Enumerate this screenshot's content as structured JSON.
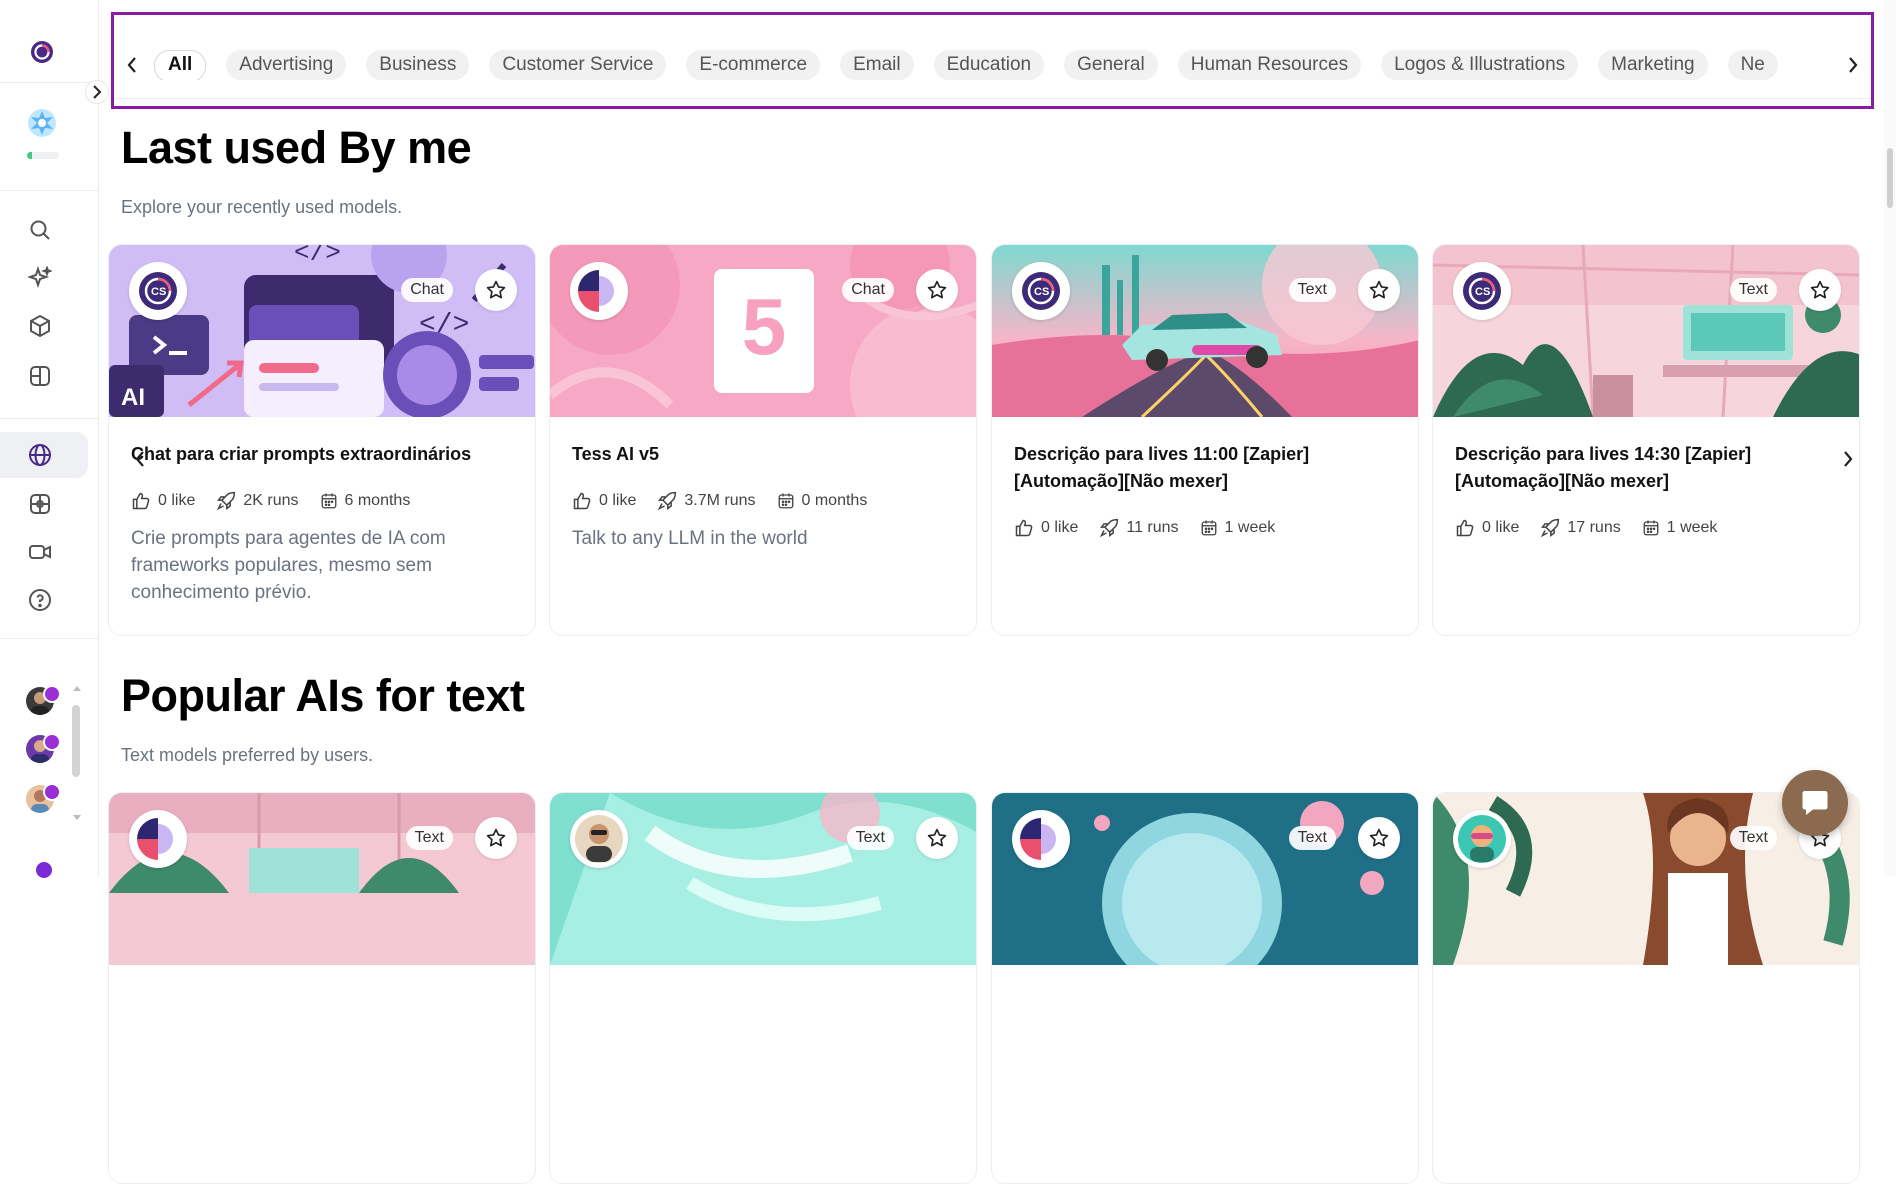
{
  "sidebar": {
    "progress_fraction": 0.15,
    "nav_icons": [
      "search-icon",
      "sparkle-icon",
      "cube-icon",
      "layout-icon",
      "globe-icon",
      "film-grid-icon",
      "video-icon",
      "help-icon"
    ],
    "active_item": "globe-icon"
  },
  "categories": {
    "items": [
      "All",
      "Advertising",
      "Business",
      "Customer Service",
      "E-commerce",
      "Email",
      "Education",
      "General",
      "Human Resources",
      "Logos & Illustrations",
      "Marketing",
      "Ne"
    ],
    "active": "All"
  },
  "recent": {
    "title": "Last used By me",
    "subtitle": "Explore your recently used models.",
    "cards": [
      {
        "badge": "Chat",
        "title": "Chat para criar prompts extraordinários",
        "likes": "0 like",
        "runs": "2K runs",
        "age": "6 months",
        "description": "Crie prompts para agentes de IA com frameworks populares, mesmo sem conhecimento prévio."
      },
      {
        "badge": "Chat",
        "title": "Tess AI v5",
        "image_text": "5",
        "likes": "0 like",
        "runs": "3.7M runs",
        "age": "0 months",
        "description": "Talk to any LLM in the world"
      },
      {
        "badge": "Text",
        "title": "Descrição para lives 11:00 [Zapier] [Automação][Não mexer]",
        "likes": "0 like",
        "runs": "11 runs",
        "age": "1 week",
        "description": ""
      },
      {
        "badge": "Text",
        "title": "Descrição para lives 14:30 [Zapier] [Automação][Não mexer]",
        "likes": "0 like",
        "runs": "17 runs",
        "age": "1 week",
        "description": ""
      }
    ]
  },
  "popular": {
    "title": "Popular AIs for text",
    "subtitle": "Text models preferred by users.",
    "cards": [
      {
        "badge": "Text"
      },
      {
        "badge": "Text"
      },
      {
        "badge": "Text"
      },
      {
        "badge": "Text"
      }
    ]
  },
  "colors": {
    "highlight_border": "#8a1c9f",
    "brand_purple": "#4b2a86",
    "chat_fab": "#8b6a4f"
  }
}
